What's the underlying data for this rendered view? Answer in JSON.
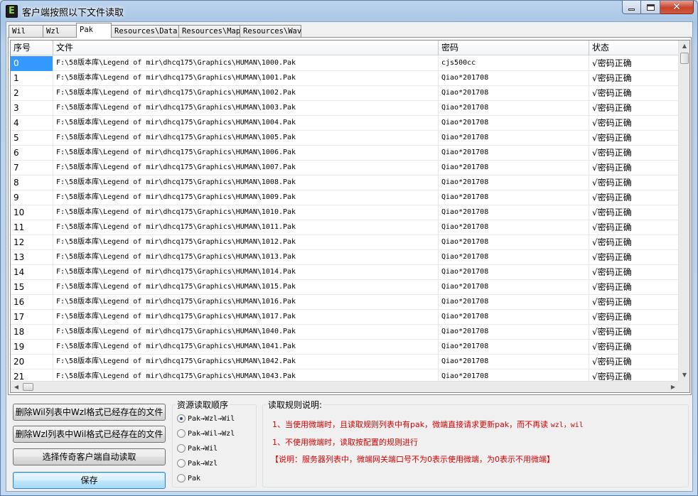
{
  "window": {
    "title": "客户端按照以下文件读取",
    "app_icon_letter": "E"
  },
  "tabs": [
    {
      "label": "Wil",
      "active": false
    },
    {
      "label": "Wzl",
      "active": false
    },
    {
      "label": "Pak",
      "active": true
    },
    {
      "label": "Resources\\Data",
      "active": false
    },
    {
      "label": "Resources\\Map",
      "active": false
    },
    {
      "label": "Resources\\Wav",
      "active": false
    }
  ],
  "table": {
    "columns": [
      "序号",
      "文件",
      "密码",
      "状态"
    ],
    "rows": [
      {
        "index": "0",
        "file": "F:\\58版本库\\Legend of mir\\dhcq175\\Graphics\\HUMAN\\1000.Pak",
        "password": "cjs500cc",
        "status": "√密码正确",
        "selected": true
      },
      {
        "index": "1",
        "file": "F:\\58版本库\\Legend of mir\\dhcq175\\Graphics\\HUMAN\\1001.Pak",
        "password": "Qiao*201708",
        "status": "√密码正确"
      },
      {
        "index": "2",
        "file": "F:\\58版本库\\Legend of mir\\dhcq175\\Graphics\\HUMAN\\1002.Pak",
        "password": "Qiao*201708",
        "status": "√密码正确"
      },
      {
        "index": "3",
        "file": "F:\\58版本库\\Legend of mir\\dhcq175\\Graphics\\HUMAN\\1003.Pak",
        "password": "Qiao*201708",
        "status": "√密码正确"
      },
      {
        "index": "4",
        "file": "F:\\58版本库\\Legend of mir\\dhcq175\\Graphics\\HUMAN\\1004.Pak",
        "password": "Qiao*201708",
        "status": "√密码正确"
      },
      {
        "index": "5",
        "file": "F:\\58版本库\\Legend of mir\\dhcq175\\Graphics\\HUMAN\\1005.Pak",
        "password": "Qiao*201708",
        "status": "√密码正确"
      },
      {
        "index": "6",
        "file": "F:\\58版本库\\Legend of mir\\dhcq175\\Graphics\\HUMAN\\1006.Pak",
        "password": "Qiao*201708",
        "status": "√密码正确"
      },
      {
        "index": "7",
        "file": "F:\\58版本库\\Legend of mir\\dhcq175\\Graphics\\HUMAN\\1007.Pak",
        "password": "Qiao*201708",
        "status": "√密码正确"
      },
      {
        "index": "8",
        "file": "F:\\58版本库\\Legend of mir\\dhcq175\\Graphics\\HUMAN\\1008.Pak",
        "password": "Qiao*201708",
        "status": "√密码正确"
      },
      {
        "index": "9",
        "file": "F:\\58版本库\\Legend of mir\\dhcq175\\Graphics\\HUMAN\\1009.Pak",
        "password": "Qiao*201708",
        "status": "√密码正确"
      },
      {
        "index": "10",
        "file": "F:\\58版本库\\Legend of mir\\dhcq175\\Graphics\\HUMAN\\1010.Pak",
        "password": "Qiao*201708",
        "status": "√密码正确"
      },
      {
        "index": "11",
        "file": "F:\\58版本库\\Legend of mir\\dhcq175\\Graphics\\HUMAN\\1011.Pak",
        "password": "Qiao*201708",
        "status": "√密码正确"
      },
      {
        "index": "12",
        "file": "F:\\58版本库\\Legend of mir\\dhcq175\\Graphics\\HUMAN\\1012.Pak",
        "password": "Qiao*201708",
        "status": "√密码正确"
      },
      {
        "index": "13",
        "file": "F:\\58版本库\\Legend of mir\\dhcq175\\Graphics\\HUMAN\\1013.Pak",
        "password": "Qiao*201708",
        "status": "√密码正确"
      },
      {
        "index": "14",
        "file": "F:\\58版本库\\Legend of mir\\dhcq175\\Graphics\\HUMAN\\1014.Pak",
        "password": "Qiao*201708",
        "status": "√密码正确"
      },
      {
        "index": "15",
        "file": "F:\\58版本库\\Legend of mir\\dhcq175\\Graphics\\HUMAN\\1015.Pak",
        "password": "Qiao*201708",
        "status": "√密码正确"
      },
      {
        "index": "16",
        "file": "F:\\58版本库\\Legend of mir\\dhcq175\\Graphics\\HUMAN\\1016.Pak",
        "password": "Qiao*201708",
        "status": "√密码正确"
      },
      {
        "index": "17",
        "file": "F:\\58版本库\\Legend of mir\\dhcq175\\Graphics\\HUMAN\\1017.Pak",
        "password": "Qiao*201708",
        "status": "√密码正确"
      },
      {
        "index": "18",
        "file": "F:\\58版本库\\Legend of mir\\dhcq175\\Graphics\\HUMAN\\1040.Pak",
        "password": "Qiao*201708",
        "status": "√密码正确"
      },
      {
        "index": "19",
        "file": "F:\\58版本库\\Legend of mir\\dhcq175\\Graphics\\HUMAN\\1041.Pak",
        "password": "Qiao*201708",
        "status": "√密码正确"
      },
      {
        "index": "20",
        "file": "F:\\58版本库\\Legend of mir\\dhcq175\\Graphics\\HUMAN\\1042.Pak",
        "password": "Qiao*201708",
        "status": "√密码正确"
      },
      {
        "index": "21",
        "file": "F:\\58版本库\\Legend of mir\\dhcq175\\Graphics\\HUMAN\\1043.Pak",
        "password": "Qiao*201708",
        "status": "√密码正确"
      }
    ]
  },
  "buttons": {
    "delete_wil": "删除Wil列表中Wzl格式已经存在的文件",
    "delete_wzl": "删除Wzl列表中Wil格式已经存在的文件",
    "select_client": "选择传奇客户端自动读取",
    "save": "保存"
  },
  "order_group": {
    "label": "资源读取顺序",
    "options": [
      {
        "label": "Pak→Wzl→Wil",
        "checked": true
      },
      {
        "label": "Pak→Wil→Wzl",
        "checked": false
      },
      {
        "label": "Pak→Wil",
        "checked": false
      },
      {
        "label": "Pak→Wzl",
        "checked": false
      },
      {
        "label": "Pak",
        "checked": false
      }
    ]
  },
  "rules_group": {
    "label": "读取规则说明:",
    "line1_prefix": "1、当使用微端时，且读取规则列表中有pak，微端直接请求更新pak，而不再读 ",
    "line1_code": "wzl，wil",
    "line2": "1、不使用微端时，读取按配置的规则进行",
    "line3": "【说明：服务器列表中，微端网关端口号不为0表示使用微端，为0表示不用微端】"
  },
  "icons": {
    "minimize": "minimize-icon",
    "maximize": "maximize-icon",
    "close": "close-icon",
    "scroll_up": "▲",
    "scroll_down": "▼",
    "scroll_left": "◀",
    "scroll_right": "▶"
  },
  "colors": {
    "selection": "#3399ff",
    "rule_text": "#d40000"
  }
}
